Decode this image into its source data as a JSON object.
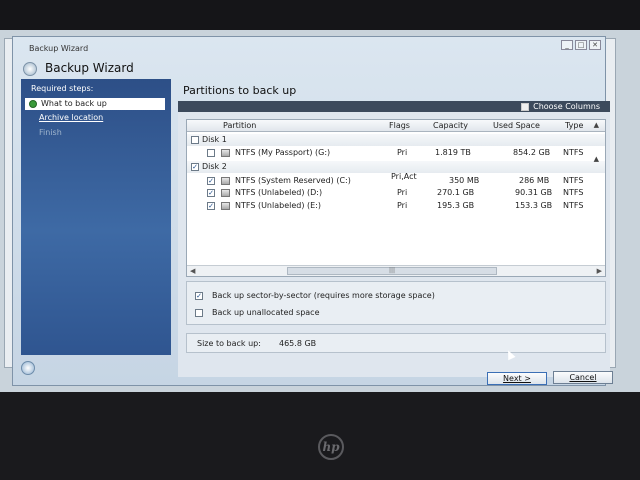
{
  "window": {
    "title": "Backup Wizard",
    "header": "Backup Wizard",
    "controls": [
      "_",
      "□",
      "✕"
    ]
  },
  "sidebar": {
    "heading": "Required steps:",
    "items": [
      {
        "label": "What to back up",
        "state": "active"
      },
      {
        "label": "Archive location",
        "state": "link"
      },
      {
        "label": "Finish",
        "state": "disabled"
      }
    ]
  },
  "main": {
    "title": "Partitions to back up",
    "choose_columns": "Choose Columns",
    "columns": [
      "Partition",
      "Flags",
      "Capacity",
      "Used Space",
      "Type"
    ],
    "disks": [
      {
        "name": "Disk 1",
        "checked": false,
        "partitions": [
          {
            "name": "NTFS (My Passport) (G:)",
            "flags": "Pri",
            "capacity": "1.819 TB",
            "used": "854.2 GB",
            "type": "NTFS",
            "checked": false
          }
        ]
      },
      {
        "name": "Disk 2",
        "checked": true,
        "partitions": [
          {
            "name": "NTFS (System Reserved) (C:)",
            "flags": "Pri,Act",
            "capacity": "350 MB",
            "used": "286 MB",
            "type": "NTFS",
            "checked": true
          },
          {
            "name": "NTFS (Unlabeled) (D:)",
            "flags": "Pri",
            "capacity": "270.1 GB",
            "used": "90.31 GB",
            "type": "NTFS",
            "checked": true
          },
          {
            "name": "NTFS (Unlabeled) (E:)",
            "flags": "Pri",
            "capacity": "195.3 GB",
            "used": "153.3 GB",
            "type": "NTFS",
            "checked": true
          }
        ]
      }
    ],
    "options": {
      "sector_by_sector": {
        "label": "Back up sector-by-sector (requires more storage space)",
        "checked": true
      },
      "unallocated": {
        "label": "Back up unallocated space",
        "checked": false
      }
    },
    "size_label": "Size to back up:",
    "size_value": "465.8 GB"
  },
  "buttons": {
    "next": "Next >",
    "cancel": "Cancel"
  },
  "monitor": {
    "brand": "hp"
  }
}
